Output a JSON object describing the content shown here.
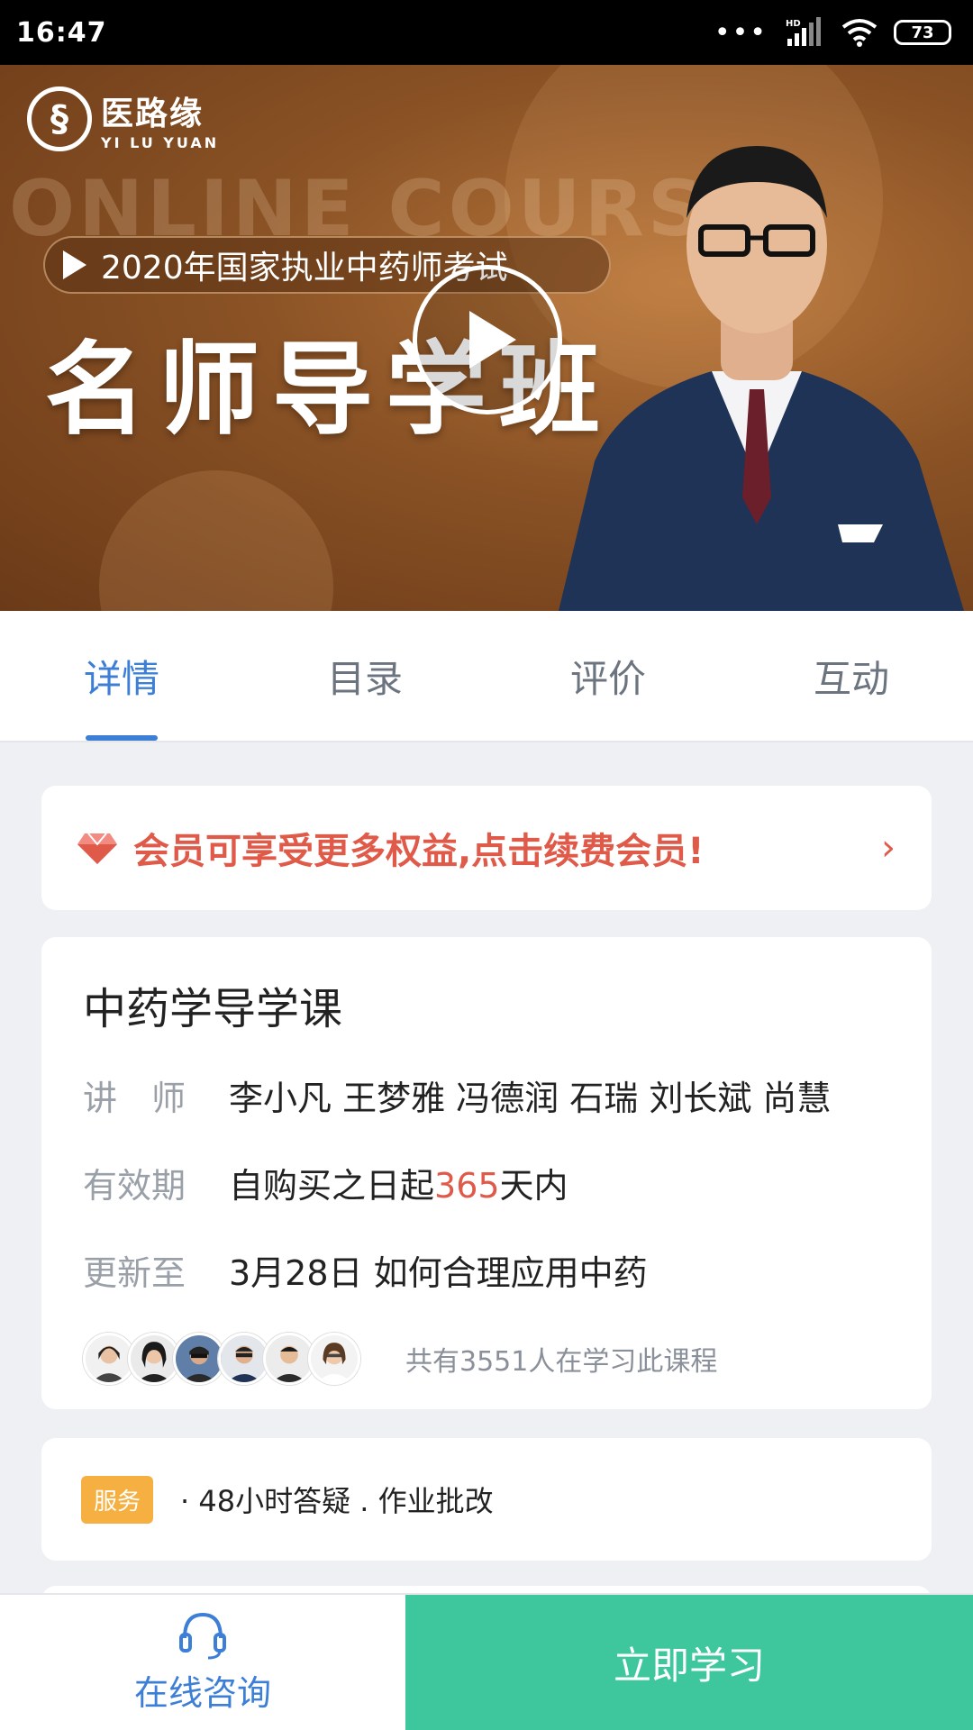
{
  "status_bar": {
    "time": "16:47",
    "network_label": "HD",
    "battery": "73"
  },
  "banner": {
    "logo_cn": "医路缘",
    "logo_en": "YI LU YUAN",
    "watermark": "ONLINE COURSE",
    "exam_title": "2020年国家执业中药师考试",
    "main_title": "名师导学班"
  },
  "tabs": [
    {
      "label": "详情",
      "active": true
    },
    {
      "label": "目录",
      "active": false
    },
    {
      "label": "评价",
      "active": false
    },
    {
      "label": "互动",
      "active": false
    }
  ],
  "vip": {
    "text": "会员可享受更多权益,点击续费会员!",
    "accent": "#e05a4a"
  },
  "course": {
    "title": "中药学导学课",
    "teacher_label": "讲　师",
    "teachers": "李小凡 王梦雅 冯德润 石瑞 刘长斌 尚慧",
    "validity_label": "有效期",
    "validity_prefix": "自购买之日起",
    "validity_days": "365",
    "validity_suffix": "天内",
    "update_label": "更新至",
    "update_value": "3月28日 如何合理应用中药",
    "learner_text": "共有3551人在学习此课程"
  },
  "service": {
    "badge": "服务",
    "text": "· 48小时答疑 . 作业批改"
  },
  "bottom": {
    "consult_label": "在线咨询",
    "study_label": "立即学习",
    "study_color": "#3ec79d"
  }
}
